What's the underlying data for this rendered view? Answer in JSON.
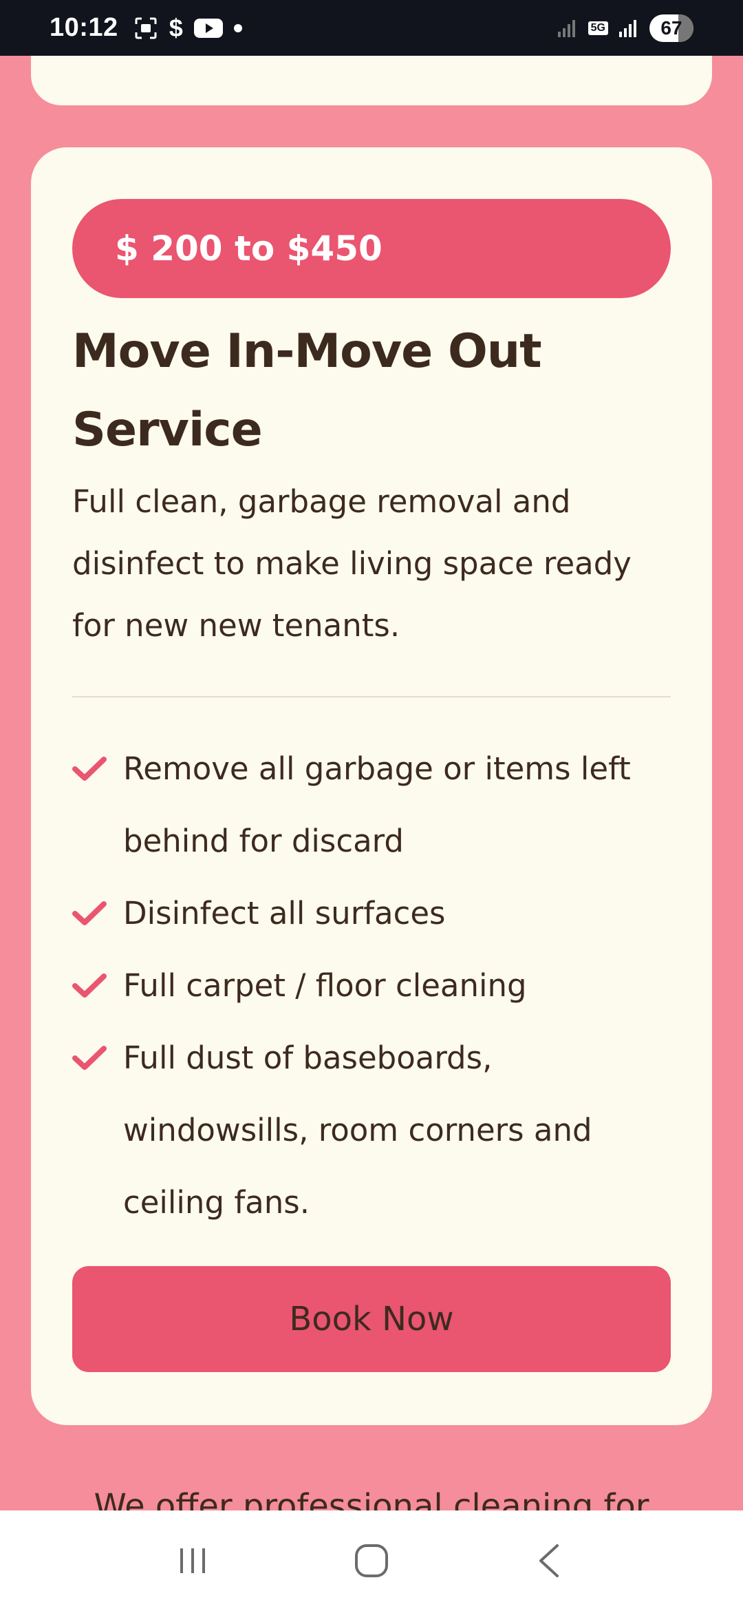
{
  "status_bar": {
    "time": "10:12",
    "battery_level": "67",
    "network": "5G",
    "left_icons": [
      "screenshot-icon",
      "dollar-icon",
      "youtube-icon",
      "dot-icon"
    ],
    "right_icons": [
      "signal-weak-icon",
      "5g-icon",
      "signal-icon",
      "battery-icon"
    ]
  },
  "service_card": {
    "price": "$ 200 to $450",
    "title_line1": "Move In-Move Out",
    "title_line2": "Service",
    "description": "Full clean, garbage removal and disinfect to make living space ready for new new tenants.",
    "features": [
      "Remove all garbage or items left behind for discard",
      "Disinfect all surfaces",
      "Full carpet / floor cleaning",
      "Full dust of baseboards, windowsills, room corners and ceiling fans."
    ],
    "book_label": "Book Now"
  },
  "bottom_text": "We offer professional cleaning for",
  "colors": {
    "background": "#f68d9a",
    "card": "#fdfaee",
    "accent": "#ea5570",
    "text": "#3d2a1f"
  },
  "nav": {
    "icons": [
      "recent-apps-icon",
      "home-icon",
      "back-icon"
    ]
  }
}
